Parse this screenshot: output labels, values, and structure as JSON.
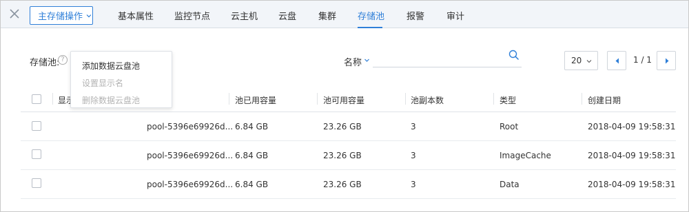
{
  "header": {
    "ops_button": "主存储操作",
    "tabs": [
      {
        "label": "基本属性"
      },
      {
        "label": "监控节点"
      },
      {
        "label": "云主机"
      },
      {
        "label": "云盘"
      },
      {
        "label": "集群"
      },
      {
        "label": "存储池",
        "active": true
      },
      {
        "label": "报警"
      },
      {
        "label": "审计"
      }
    ]
  },
  "toolbar": {
    "pool_label": "存储池:",
    "help_glyph": "?",
    "search_field": "名称",
    "search_placeholder": "",
    "page_size": "20",
    "page_info": "1 / 1"
  },
  "menu": {
    "items": [
      {
        "label": "添加数据云盘池",
        "enabled": true
      },
      {
        "label": "设置显示名",
        "enabled": false
      },
      {
        "label": "删除数据云盘池",
        "enabled": false
      }
    ]
  },
  "table": {
    "columns": [
      "显示名",
      "池已用容量",
      "池可用容量",
      "池副本数",
      "类型",
      "创建日期"
    ],
    "rows": [
      {
        "name": "pool-5396e69926d...",
        "used": "6.84 GB",
        "available": "23.26 GB",
        "replicas": "3",
        "type": "Root",
        "created": "2018-04-09 19:58:31"
      },
      {
        "name": "pool-5396e69926d...",
        "used": "6.84 GB",
        "available": "23.26 GB",
        "replicas": "3",
        "type": "ImageCache",
        "created": "2018-04-09 19:58:31"
      },
      {
        "name": "pool-5396e69926d...",
        "used": "6.84 GB",
        "available": "23.26 GB",
        "replicas": "3",
        "type": "Data",
        "created": "2018-04-09 19:58:31"
      }
    ]
  },
  "colors": {
    "accent": "#2f7fd8",
    "topbar_bg": "#f2f5f9",
    "disabled_text": "#b3b3b3"
  },
  "icons": [
    "close-icon",
    "chevron-down-icon",
    "help-icon",
    "search-icon",
    "chevron-left-icon",
    "chevron-right-icon"
  ]
}
